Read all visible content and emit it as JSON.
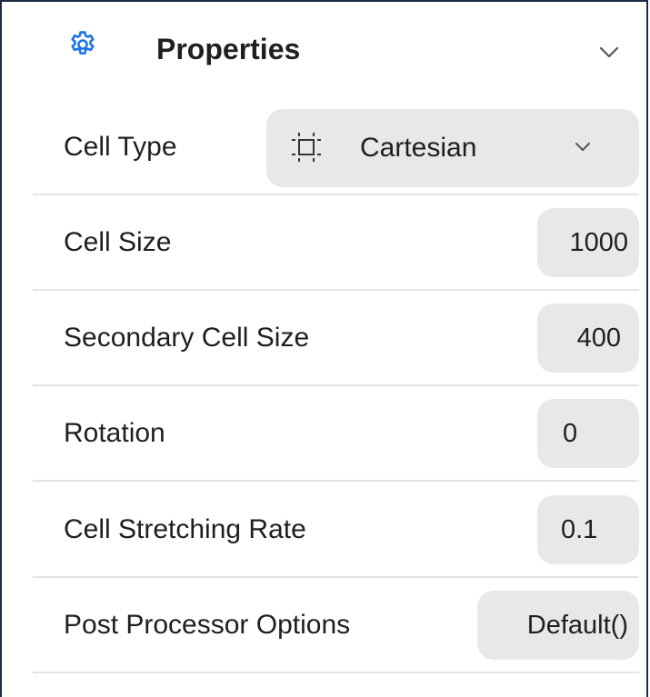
{
  "panel": {
    "title": "Properties",
    "header_icon": "gear-icon",
    "collapse_icon": "chevron-down-icon",
    "accent_color": "#1a73e8"
  },
  "properties": {
    "cell_type": {
      "label": "Cell Type",
      "value": "Cartesian",
      "icon": "cartesian-grid-icon"
    },
    "cell_size": {
      "label": "Cell Size",
      "value": "1000"
    },
    "secondary_cell_size": {
      "label": "Secondary Cell Size",
      "value": "400"
    },
    "rotation": {
      "label": "Rotation",
      "value": "0"
    },
    "cell_stretching_rate": {
      "label": "Cell Stretching Rate",
      "value": "0.1"
    },
    "post_processor_options": {
      "label": "Post Processor Options",
      "value": "Default()"
    }
  }
}
